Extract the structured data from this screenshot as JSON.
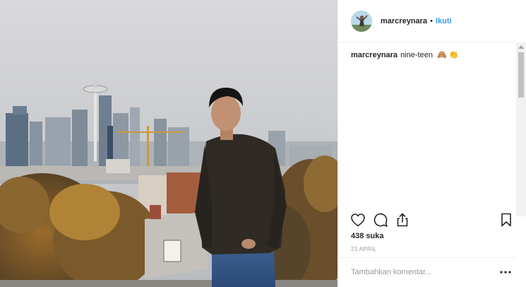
{
  "post": {
    "username": "marcreynara",
    "separator": "•",
    "follow_label": "Ikuti",
    "caption_username": "marcreynara",
    "caption_text": "nine-teen",
    "caption_emojis": [
      "🙈",
      "👏"
    ],
    "likes": "438 suka",
    "date": "23 APRIL",
    "comment_placeholder": "Tambahkan komentar...",
    "more_icon": "ellipsis-icon"
  },
  "icons": {
    "like": "heart-icon",
    "comment": "comment-icon",
    "share": "share-icon",
    "save": "bookmark-icon"
  },
  "colors": {
    "follow": "#3897f0",
    "text": "#262626",
    "muted": "#999999",
    "border": "#efefef"
  }
}
